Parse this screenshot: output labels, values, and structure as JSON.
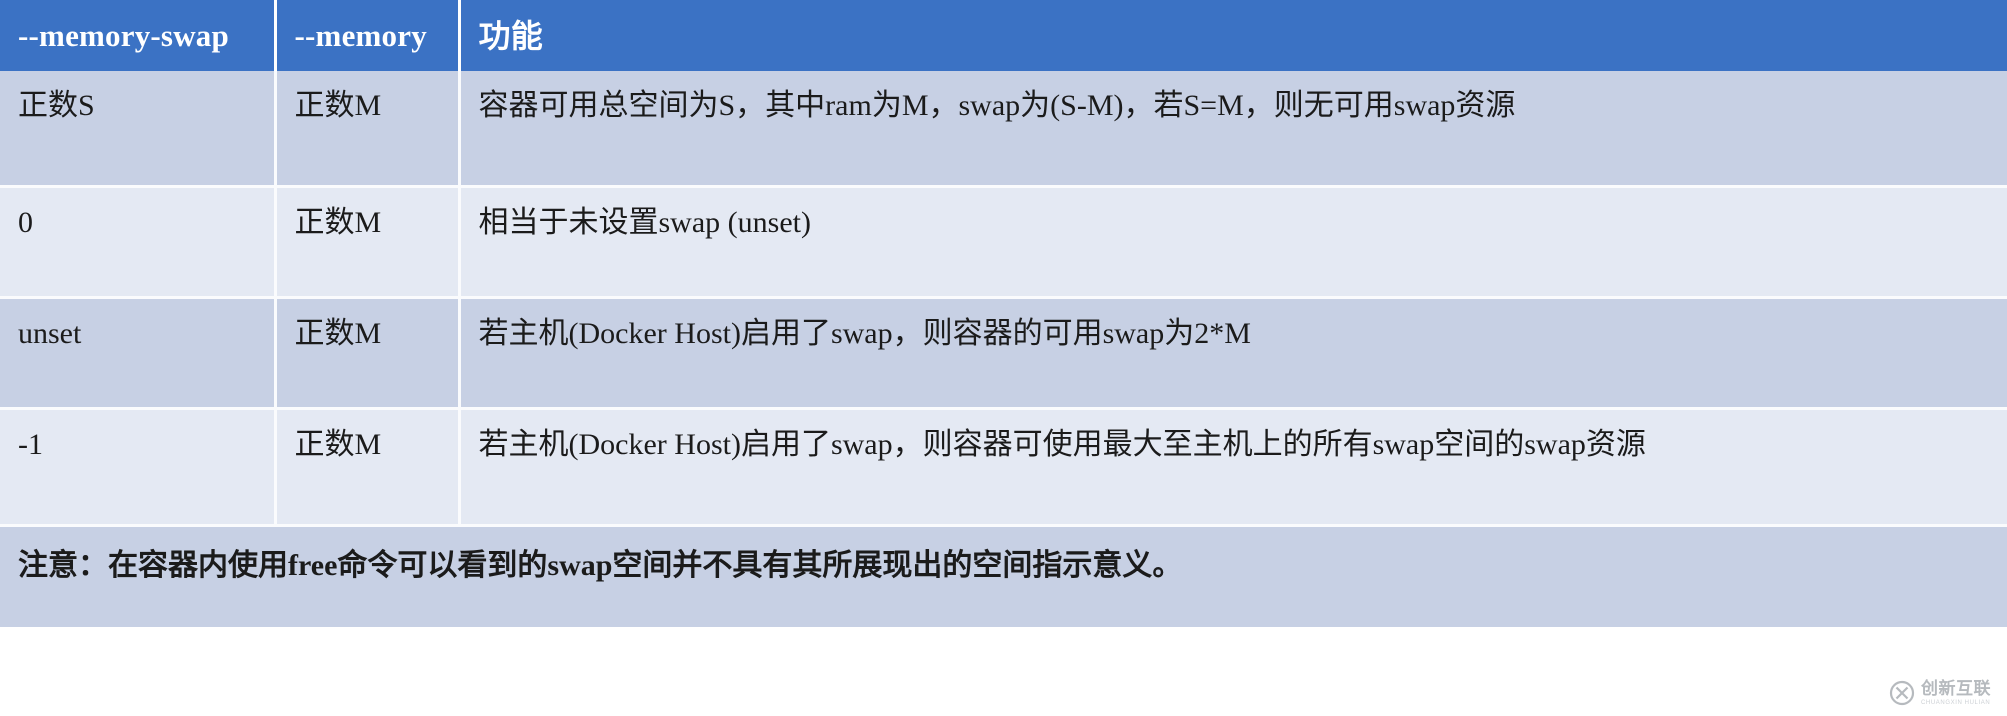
{
  "table": {
    "columns": [
      {
        "id": "memory-swap",
        "label": "--memory-swap"
      },
      {
        "id": "memory",
        "label": "--memory"
      },
      {
        "id": "function",
        "label": "功能"
      }
    ],
    "rows": [
      {
        "swap": "正数S",
        "memory": "正数M",
        "desc": "容器可用总空间为S，其中ram为M，swap为(S-M)，若S=M，则无可用swap资源"
      },
      {
        "swap": "0",
        "memory": "正数M",
        "desc": "相当于未设置swap (unset)"
      },
      {
        "swap": "unset",
        "memory": "正数M",
        "desc": "若主机(Docker Host)启用了swap，则容器的可用swap为2*M"
      },
      {
        "swap": "-1",
        "memory": "正数M",
        "desc": "若主机(Docker Host)启用了swap，则容器可使用最大至主机上的所有swap空间的swap资源"
      }
    ],
    "note": "注意：在容器内使用free命令可以看到的swap空间并不具有其所展现出的空间指示意义。"
  },
  "watermark": {
    "name_cn": "创新互联",
    "name_en": "CHUANGXIN HULIAN"
  },
  "colors": {
    "header_bg": "#3b72c4",
    "header_fg": "#ffffff",
    "row_dark": "#c7d0e4",
    "row_light": "#e4e9f3",
    "text": "#1b1b1b"
  }
}
